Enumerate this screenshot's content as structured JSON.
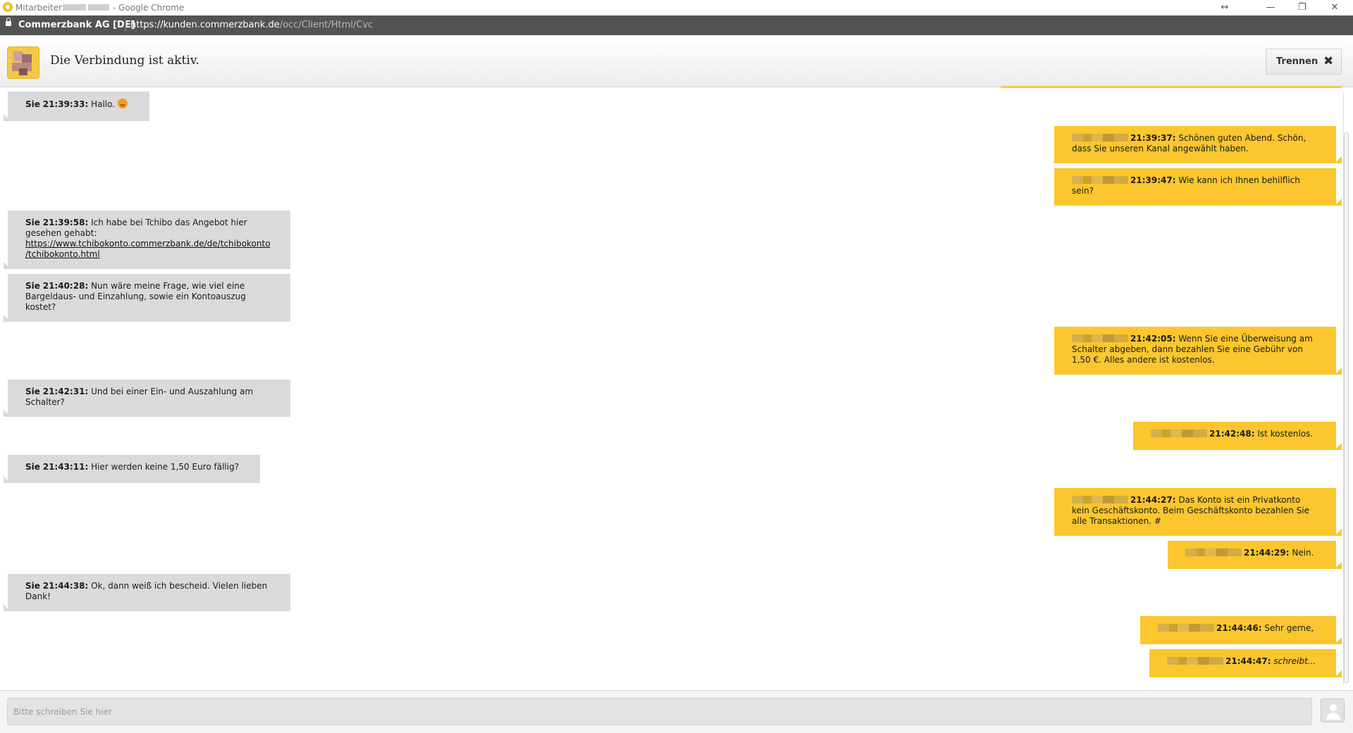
{
  "window": {
    "title_prefix": "Mitarbeiter:",
    "title_suffix": "- Google Chrome",
    "controls": {
      "resize": "↔",
      "minimize": "—",
      "restore": "❐",
      "close": "✕"
    }
  },
  "addressbar": {
    "site_label": "Commerzbank AG [DE]",
    "url_scheme": "https://",
    "url_host": "kunden.commerzbank.de",
    "url_path": "/occ/Client/Html/Cvc"
  },
  "header": {
    "status": "Die Verbindung ist aktiv.",
    "disconnect_label": "Trennen",
    "disconnect_icon": "close-icon"
  },
  "messages": [
    {
      "who": "Sie",
      "time": "21:39:33",
      "text": "Hallo.",
      "emoji": "smiley-icon"
    },
    {
      "who": "agent",
      "time": "21:39:37",
      "text": "Schönen guten Abend. Schön, dass Sie unseren Kanal angewählt haben."
    },
    {
      "who": "agent",
      "time": "21:39:47",
      "text": "Wie kann ich Ihnen behilflich sein?"
    },
    {
      "who": "Sie",
      "time": "21:39:58",
      "text": "Ich habe bei Tchibo das Angebot hier gesehen gehabt:",
      "link": "https://www.tchibokonto.commerzbank.de/de/tchibokonto /tchibokonto.html"
    },
    {
      "who": "Sie",
      "time": "21:40:28",
      "text": "Nun wäre meine Frage, wie viel eine Bargeldaus- und Einzahlung, sowie ein Kontoauszug kostet?"
    },
    {
      "who": "agent",
      "time": "21:42:05",
      "text": "Wenn Sie eine Überweisung am Schalter abgeben, dann bezahlen Sie eine Gebühr von 1,50 €. Alles andere ist kostenlos."
    },
    {
      "who": "Sie",
      "time": "21:42:31",
      "text": "Und bei einer Ein- und Auszahlung am Schalter?"
    },
    {
      "who": "agent",
      "time": "21:42:48",
      "text": "Ist kostenlos."
    },
    {
      "who": "Sie",
      "time": "21:43:11",
      "text": "Hier werden keine 1,50 Euro fällig?"
    },
    {
      "who": "agent",
      "time": "21:44:27",
      "text": "Das Konto ist ein Privatkonto kein Geschäftskonto. Beim Geschäftskonto bezahlen Sie alle Transaktionen. #"
    },
    {
      "who": "agent",
      "time": "21:44:29",
      "text": "Nein."
    },
    {
      "who": "Sie",
      "time": "21:44:38",
      "text": "Ok, dann weiß ich bescheid. Vielen lieben Dank!"
    },
    {
      "who": "agent",
      "time": "21:44:46",
      "text": "Sehr gerne,"
    },
    {
      "who": "agent",
      "time": "21:44:47",
      "text": "schreibt...",
      "italic": true
    }
  ],
  "composer": {
    "placeholder": "Bitte schreiben Sie hier",
    "profile_icon": "user-icon"
  },
  "colors": {
    "agent_bubble": "#fbc62e",
    "user_bubble": "#dadada",
    "addressbar": "#535353"
  }
}
